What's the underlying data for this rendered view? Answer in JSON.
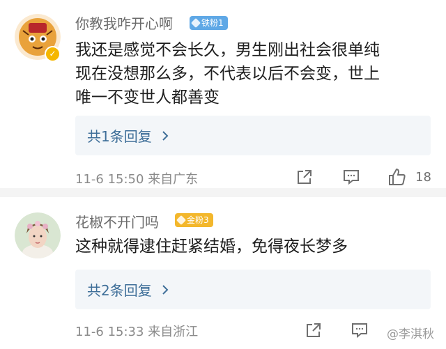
{
  "comments": [
    {
      "username": "你教我咋开心啊",
      "fan_badge": "铁粉1",
      "text_lines": [
        "我还是感觉不会长久，男生刚出社会很单纯",
        "现在没想那么多，不代表以后不会变，世上",
        "唯一不变世人都善变"
      ],
      "replies_label": "共1条回复",
      "time": "11-6 15:50",
      "location": "来自广东",
      "like_count": "18"
    },
    {
      "username": "花椒不开门吗",
      "fan_badge": "金粉3",
      "text_lines": [
        "这种就得逮住赶紧结婚，免得夜长梦多"
      ],
      "replies_label": "共2条回复",
      "time": "11-6 15:33",
      "location": "来自浙江"
    }
  ],
  "watermark": "@李淇秋",
  "colors": {
    "name": "#6b6b6b",
    "text": "#1e1e1e",
    "replies_bg": "#f3f6f9",
    "replies_text": "#3f6f99",
    "iron_badge": "#5fa8e6",
    "gold_badge": "#f3b72c",
    "verified": "#f5b700"
  },
  "icons": [
    "verified-icon",
    "share-icon",
    "comment-icon",
    "like-icon",
    "chevron-right-icon"
  ]
}
